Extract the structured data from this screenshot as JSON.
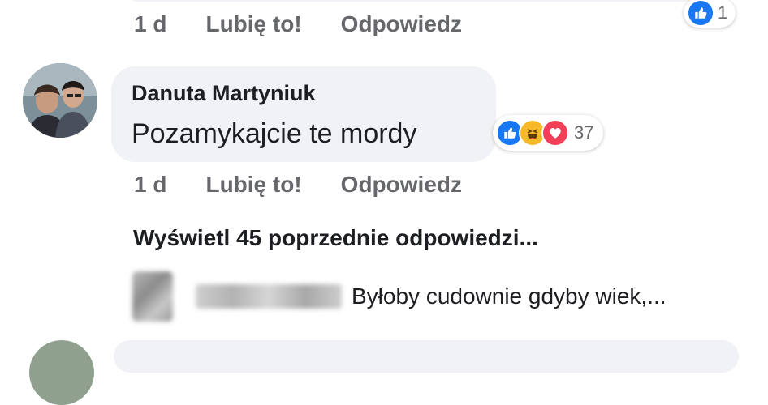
{
  "previous_comment": {
    "time": "1 d",
    "like_label": "Lubię to!",
    "reply_label": "Odpowiedz",
    "reaction_count": "1",
    "reaction_icon": "like-icon"
  },
  "comment": {
    "author": "Danuta Martyniuk",
    "text": "Pozamykajcie te mordy",
    "reaction_icons": [
      "like-icon",
      "haha-icon",
      "love-icon"
    ],
    "reaction_count": "37",
    "time": "1 d",
    "like_label": "Lubię to!",
    "reply_label": "Odpowiedz"
  },
  "replies": {
    "view_previous_label": "Wyświetl 45 poprzednie odpowiedzi...",
    "last_reply_text": "Byłoby cudownie gdyby wiek,..."
  },
  "colors": {
    "bubble": "#f0f2f5",
    "meta_text": "#65676b",
    "like_blue": "#1877f2",
    "haha_yellow": "#f7b928",
    "love_red": "#f33e58"
  }
}
